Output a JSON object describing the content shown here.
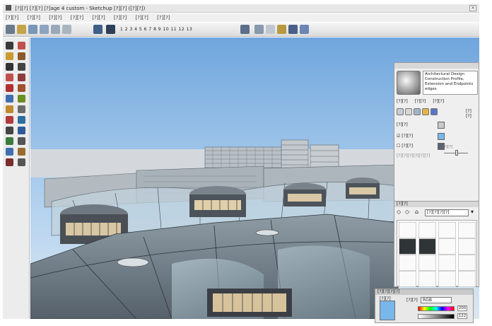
{
  "window": {
    "title": "[?][?] [?][?] [?]age 4 custom - Sketchup [?][?] ([?][?])",
    "close_glyph": "×"
  },
  "menus": [
    "[?][?]",
    "[?][?]",
    "[?][?]",
    "[?][?]",
    "[?][?]",
    "[?][?]",
    "[?][?]",
    "[?][?]"
  ],
  "toolbar": {
    "scene_strip": "1 2 3 4 5 6 7 8 9 10 11 12 13"
  },
  "materials_panel": {
    "description": "Architectural Design Construction Profile, Extension and Endpoints edges",
    "tabs": [
      "[?][?]",
      "[?][?]",
      "[?][?]"
    ],
    "style_label": "[?][?]",
    "rows": [
      {
        "label": "[?][?]",
        "checked": false,
        "color": "#c9c9c9"
      },
      {
        "label": "[?][?]",
        "checked": true,
        "color": "#79b6ea"
      },
      {
        "label": "[?][?]",
        "checked": false,
        "color": "#5b6272"
      }
    ],
    "footer": "[?][?][?][?][?][?]",
    "slider_label": "[?][?]"
  },
  "swatch_panel": {
    "title": "[?][?]",
    "dropdown": "[?][?][?][?]"
  },
  "color_panel": {
    "title": "[?][?][?][?]",
    "mode_label": "[?][?]",
    "picker_label": "[?][?]",
    "dropdown": "RGB",
    "values": [
      "200",
      "122"
    ],
    "accent_color": "#79b6ea"
  },
  "icons": {
    "toolbar": [
      "select-arrow-icon",
      "eraser-icon",
      "paint-bucket-icon",
      "rectangle-icon",
      "circle-icon",
      "arc-icon",
      "pencil-icon",
      "push-pull-icon",
      "move-icon",
      "rotate-icon",
      "scale-icon",
      "offset-icon",
      "tape-measure-icon",
      "protractor-icon",
      "text-icon",
      "axes-icon",
      "dimension-icon",
      "orbit-icon",
      "pan-icon",
      "zoom-icon",
      "zoom-extents-icon",
      "walk-icon",
      "look-around-icon",
      "section-plane-icon"
    ]
  }
}
